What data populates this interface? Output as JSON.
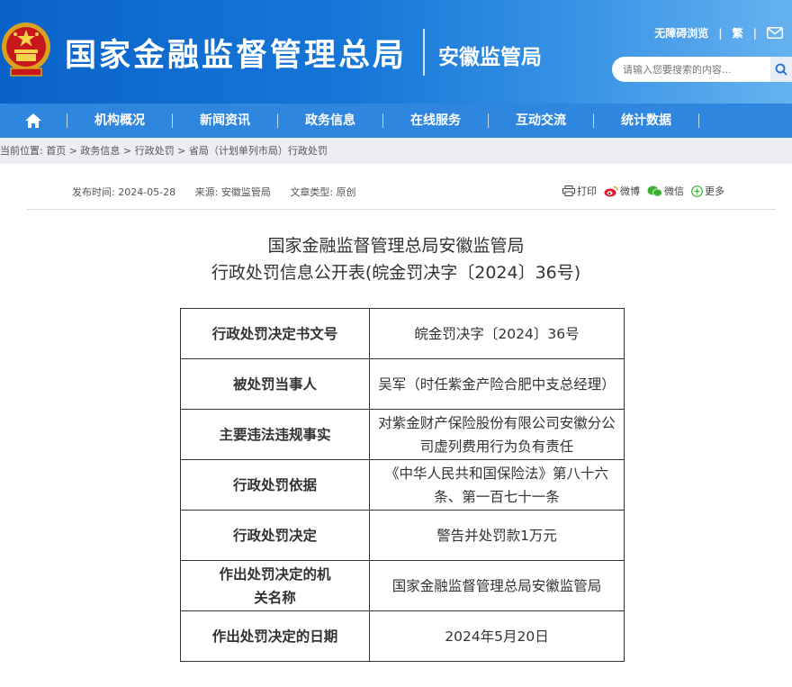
{
  "header": {
    "site_title": "国家金融监督管理总局",
    "sub_title": "安徽监管局",
    "accessibility": "无障碍浏览",
    "traditional": "繁",
    "search_placeholder": "请输入您要搜索的内容..."
  },
  "nav": {
    "items": [
      {
        "label": "机构概况"
      },
      {
        "label": "新闻资讯"
      },
      {
        "label": "政务信息"
      },
      {
        "label": "在线服务"
      },
      {
        "label": "互动交流"
      },
      {
        "label": "统计数据"
      }
    ]
  },
  "breadcrumb": {
    "text": "当前位置:  首页 > 政务信息 > 行政处罚 > 省局（计划单列市局）行政处罚"
  },
  "meta": {
    "publish_time": "发布时间:  2024-05-28",
    "source": "来源:  安徽监管局",
    "doc_type": "文章类型:  原创"
  },
  "share": {
    "print": "打印",
    "weibo": "微博",
    "wechat": "微信",
    "more": "更多"
  },
  "article": {
    "title_line1": "国家金融监督管理总局安徽监管局",
    "title_line2": "行政处罚信息公开表(皖金罚决字〔2024〕36号)"
  },
  "table": {
    "rows": [
      {
        "key": "行政处罚决定书文号",
        "value": "皖金罚决字〔2024〕36号"
      },
      {
        "key": "被处罚当事人",
        "value": "吴军（时任紫金产险合肥中支总经理）"
      },
      {
        "key": "主要违法违规事实",
        "value": "对紫金财产保险股份有限公司安徽分公司虚列费用行为负有责任"
      },
      {
        "key": "行政处罚依据",
        "value": "《中华人民共和国保险法》第八十六条、第一百七十一条"
      },
      {
        "key": "行政处罚决定",
        "value": "警告并处罚款1万元"
      },
      {
        "key": "作出处罚决定的机关名称",
        "value": "国家金融监督管理总局安徽监管局"
      },
      {
        "key": "作出处罚决定的日期",
        "value": "2024年5月20日"
      }
    ]
  }
}
